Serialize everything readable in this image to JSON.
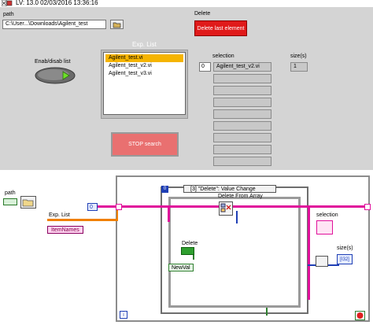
{
  "window": {
    "title": "LV: 13.0 02/03/2016 13:36:16"
  },
  "front_panel": {
    "path": {
      "label": "path",
      "value": "C:\\User...\\Downloads\\Agilent_test"
    },
    "delete": {
      "label": "Delete",
      "button_text": "Delete last element"
    },
    "enab_disab": {
      "label": "Enab/disab list"
    },
    "exp_list": {
      "label": "Exp. List",
      "items": [
        "Agilent_test.vi",
        "Agilent_test_v2.vi",
        "Agilent_test_v3.vi"
      ],
      "selected_index": 0
    },
    "selection": {
      "label": "selection",
      "index": "0",
      "first_value": "Agilent_test_v2.vi"
    },
    "size": {
      "label": "size(s)",
      "value": "1"
    },
    "stop": {
      "label": "STOP search"
    }
  },
  "block_diagram": {
    "path_label": "path",
    "exp_list_label": "Exp. List",
    "item_names": "ItemNames",
    "constant_zero": "0",
    "event_case": "[3] \"Delete\": Value Change",
    "event_selector_mark": "0",
    "delete_from_array": "Delete From Array",
    "delete_label": "Delete",
    "newval_label": "NewVal",
    "selection_label": "selection",
    "size_label": "size(s)",
    "size_term": "[I32]",
    "iteration": "i",
    "colors": {
      "string_wire": "#e0109b",
      "array_wire": "#f08000",
      "int_wire": "#1f3fb5",
      "bool_wire": "#2f7f2f"
    }
  }
}
